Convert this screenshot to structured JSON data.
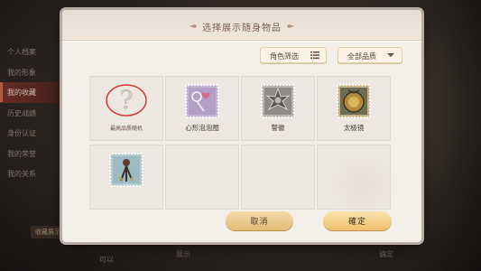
{
  "background_menu": {
    "items": [
      {
        "label": "个人档案",
        "active": false
      },
      {
        "label": "我的形象",
        "active": false
      },
      {
        "label": "我的收藏",
        "active": true
      },
      {
        "label": "历史战绩",
        "active": false
      },
      {
        "label": "身份认证",
        "active": false
      },
      {
        "label": "我的荣誉",
        "active": false
      },
      {
        "label": "我的关系",
        "active": false
      }
    ],
    "tag": "收藏展示",
    "status_left": "可以",
    "status_mid": "展示",
    "status_right": "确定"
  },
  "dialog": {
    "title": "选择展示随身物品",
    "filters": {
      "role_label": "角色筛选",
      "quality_label": "全部品质"
    },
    "items": [
      {
        "label": "最高品质随机",
        "icon": "question-mark-icon"
      },
      {
        "label": "心形泡泡圈",
        "icon": "heart-bubble-stamp-icon"
      },
      {
        "label": "警徽",
        "icon": "police-badge-stamp-icon"
      },
      {
        "label": "太极镜",
        "icon": "taiji-mirror-stamp-icon"
      },
      {
        "label": "",
        "icon": "feather-charm-stamp-icon"
      },
      {
        "label": "",
        "icon": ""
      },
      {
        "label": "",
        "icon": ""
      },
      {
        "label": "",
        "icon": ""
      }
    ],
    "cancel_label": "取消",
    "confirm_label": "確定"
  },
  "colors": {
    "accent": "#e4bb78",
    "active_menu": "#7a2f26",
    "dialog_bg": "#f3efe9"
  }
}
